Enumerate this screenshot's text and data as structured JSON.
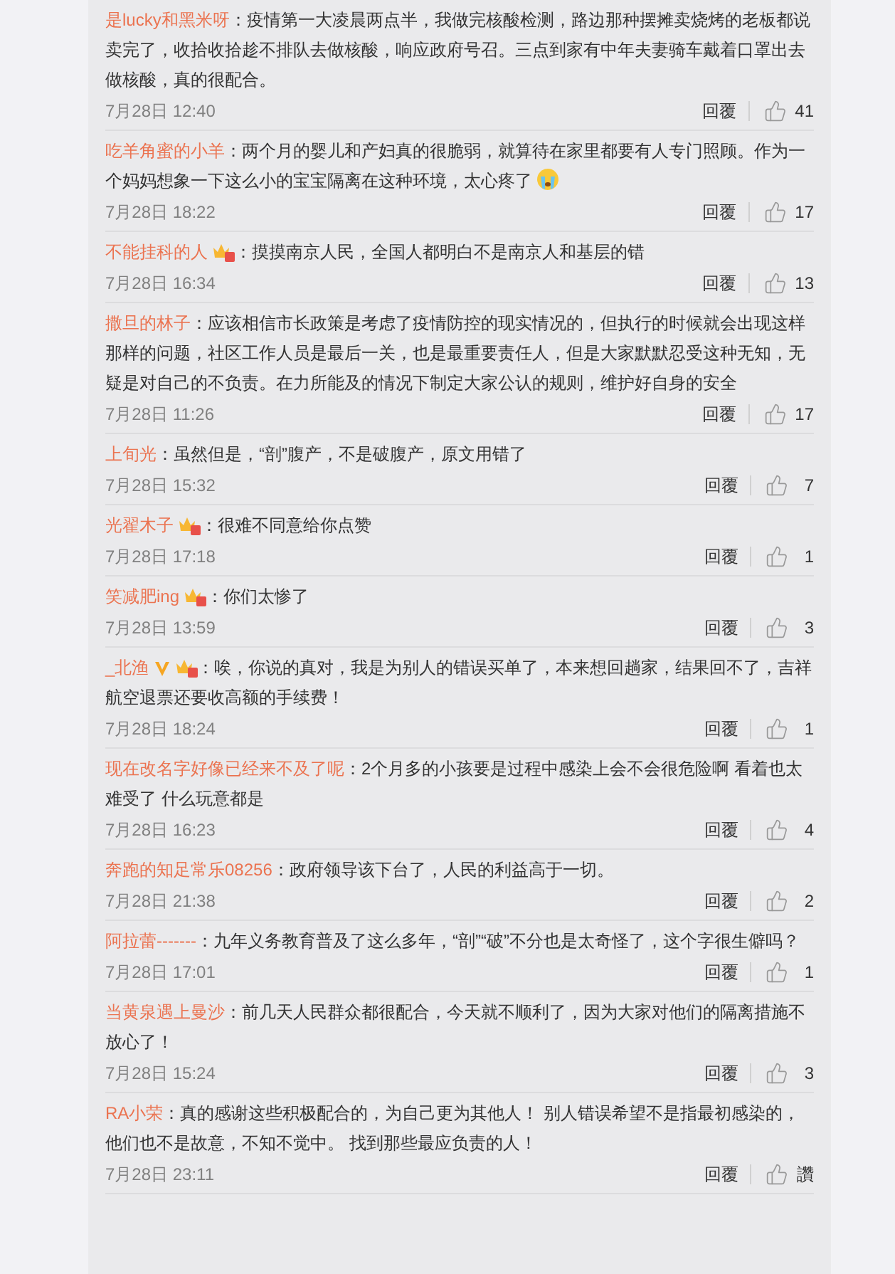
{
  "comments": [
    {
      "user": "是lucky和黑米呀",
      "text": "：疫情第一大凌晨两点半，我做完核酸检测，路边那种摆摊卖烧烤的老板都说卖完了，收拾收拾趁不排队去做核酸，响应政府号召。三点到家有中年夫妻骑车戴着口罩出去做核酸，真的很配合。",
      "date": "7月28日 12:40",
      "reply": "回覆",
      "likes": "41"
    },
    {
      "user": "吃羊角蜜的小羊",
      "text": "：两个月的婴儿和产妇真的很脆弱，就算待在家里都要有人专门照顾。作为一个妈妈想象一下这么小的宝宝隔离在这种环境，太心疼了",
      "emoji_icon": {
        "kind": "crying"
      },
      "date": "7月28日 18:22",
      "reply": "回覆",
      "likes": "17"
    },
    {
      "user": "不能挂科的人",
      "badges": [
        {
          "kind": "crown"
        }
      ],
      "text": "：摸摸南京人民，全国人都明白不是南京人和基层的错",
      "date": "7月28日 16:34",
      "reply": "回覆",
      "likes": "13"
    },
    {
      "user": "撒旦的林子",
      "text": "：应该相信市长政策是考虑了疫情防控的现实情况的，但执行的时候就会出现这样那样的问题，社区工作人员是最后一关，也是最重要责任人，但是大家默默忍受这种无知，无疑是对自己的不负责。在力所能及的情况下制定大家公认的规则，维护好自身的安全",
      "date": "7月28日 11:26",
      "reply": "回覆",
      "likes": "17"
    },
    {
      "user": "上旬光",
      "text": "：虽然但是，“剖”腹产，不是破腹产，原文用错了",
      "date": "7月28日 15:32",
      "reply": "回覆",
      "likes": "7"
    },
    {
      "user": "光翟木子",
      "badges": [
        {
          "kind": "crown"
        }
      ],
      "text": "：很难不同意给你点赞",
      "date": "7月28日 17:18",
      "reply": "回覆",
      "likes": "1"
    },
    {
      "user": "笑减肥ing",
      "badges": [
        {
          "kind": "crown"
        }
      ],
      "text": "：你们太惨了",
      "date": "7月28日 13:59",
      "reply": "回覆",
      "likes": "3"
    },
    {
      "user": "_北渔",
      "badges": [
        {
          "kind": "verified"
        },
        {
          "kind": "crown"
        }
      ],
      "text": "：唉，你说的真对，我是为别人的错误买单了，本来想回趟家，结果回不了，吉祥航空退票还要收高额的手续费！",
      "date": "7月28日 18:24",
      "reply": "回覆",
      "likes": "1"
    },
    {
      "user": "现在改名字好像已经来不及了呢",
      "text": "：2个月多的小孩要是过程中感染上会不会很危险啊 看着也太难受了 什么玩意都是",
      "date": "7月28日 16:23",
      "reply": "回覆",
      "likes": "4"
    },
    {
      "user": "奔跑的知足常乐08256",
      "text": "：政府领导该下台了，人民的利益高于一切。",
      "date": "7月28日 21:38",
      "reply": "回覆",
      "likes": "2"
    },
    {
      "user": "阿拉蕾-------",
      "text": "：九年义务教育普及了这么多年，“剖”“破”不分也是太奇怪了，这个字很生僻吗？",
      "date": "7月28日 17:01",
      "reply": "回覆",
      "likes": "1"
    },
    {
      "user": "当黄泉遇上曼沙",
      "text": "：前几天人民群众都很配合，今天就不顺利了，因为大家对他们的隔离措施不放心了！",
      "date": "7月28日 15:24",
      "reply": "回覆",
      "likes": "3"
    },
    {
      "user": "RA小荣",
      "text": "：真的感谢这些积极配合的，为自己更为其他人！ 别人错误希望不是指最初感染的，他们也不是故意，不知不觉中。 找到那些最应负责的人！",
      "date": "7月28日 23:11",
      "reply": "回覆",
      "likes": "讚"
    }
  ]
}
